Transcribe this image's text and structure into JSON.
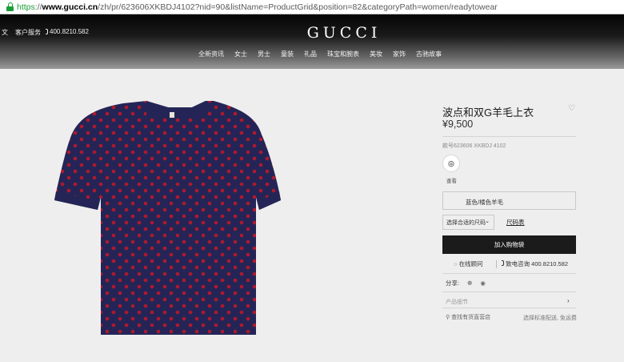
{
  "browser": {
    "url_scheme": "https",
    "url_sep": "://",
    "url_host": "www.gucci.cn",
    "url_path": "/zh/pr/623606XKBDJ4102?nid=90&listName=ProductGrid&position=82&categoryPath=women/readytowear"
  },
  "header": {
    "lang": "文",
    "service": "客户服务",
    "phone": "400.8210.582",
    "logo": "GUCCI",
    "nav": [
      "全新资讯",
      "女士",
      "男士",
      "童装",
      "礼品",
      "珠宝和腕表",
      "美妆",
      "家饰",
      "古驰故事"
    ]
  },
  "product": {
    "title": "波点和双G羊毛上衣",
    "price": "¥9,500",
    "sku": "款号623606 XKBDJ 4102",
    "swatch_label": "查看",
    "color": "蓝色/橘色羊毛",
    "size_select": "选择合适的尺码",
    "size_guide": "尺码表",
    "add_to_bag": "加入购物袋",
    "chat": "在线顾问",
    "tel": "致电咨询 400.8210.582",
    "share": "分享:",
    "details": "产品细节",
    "store": "查找有货直营店",
    "shipping": "选择标准配送, 免运费"
  },
  "colors": {
    "shirt_base": "#242556",
    "dot": "#b0182e",
    "accent_button": "#1b1b1b"
  },
  "icons": {
    "heart": "♡",
    "chevron_down": "⌄",
    "chevron_right": "›",
    "swatch": "⊛",
    "chat": "◌",
    "wechat": "❁",
    "weibo": "◉",
    "location": "⚲"
  }
}
